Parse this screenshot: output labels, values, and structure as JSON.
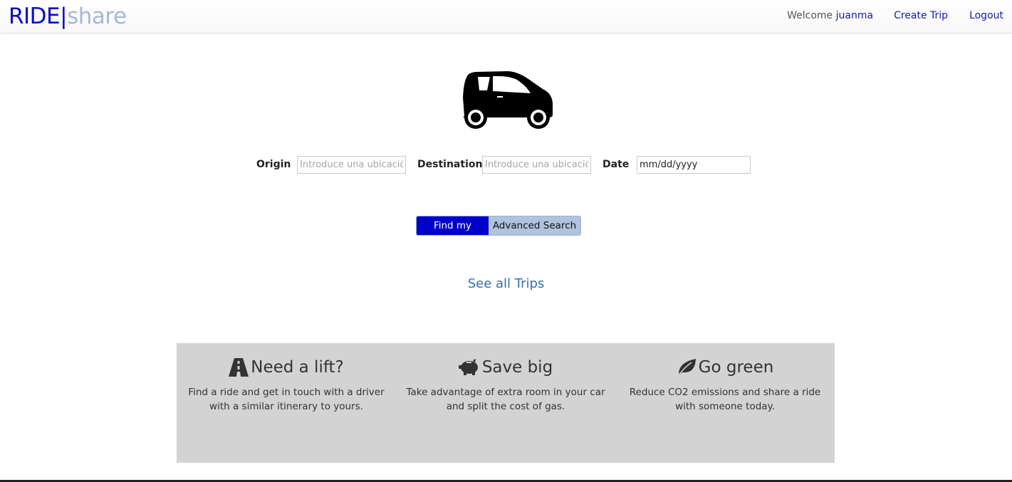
{
  "brand": {
    "part1": "RIDE",
    "separator": "|",
    "part2": "share"
  },
  "nav": {
    "welcome_prefix": "Welcome",
    "username": "juanma",
    "create_trip": "Create Trip",
    "logout": "Logout"
  },
  "hero": {
    "icon": "car-icon"
  },
  "search": {
    "origin_label": "Origin",
    "origin_placeholder": "Introduce una ubicación",
    "destination_label": "Destination",
    "destination_placeholder": "Introduce una ubicación",
    "date_label": "Date",
    "date_value": "mm/dd/yyyy"
  },
  "buttons": {
    "find": "Find my ride",
    "advanced": "Advanced Search"
  },
  "see_all": "See all Trips",
  "features": [
    {
      "icon": "road-icon",
      "title": "Need a lift?",
      "text": "Find a ride and get in touch with a driver with a similar itinerary to yours."
    },
    {
      "icon": "piggy-bank-icon",
      "title": "Save big",
      "text": "Take advantage of extra room in your car and split the cost of gas."
    },
    {
      "icon": "leaf-icon",
      "title": "Go green",
      "text": "Reduce CO2 emissions and share a ride with someone today."
    }
  ],
  "colors": {
    "brand_blue": "#0a0ac9",
    "brand_light": "#a9b6d6",
    "primary_button": "#0000cc",
    "secondary_button": "#b0c2dd",
    "features_bg": "#d3d3d3",
    "link": "#3a6ea8"
  }
}
